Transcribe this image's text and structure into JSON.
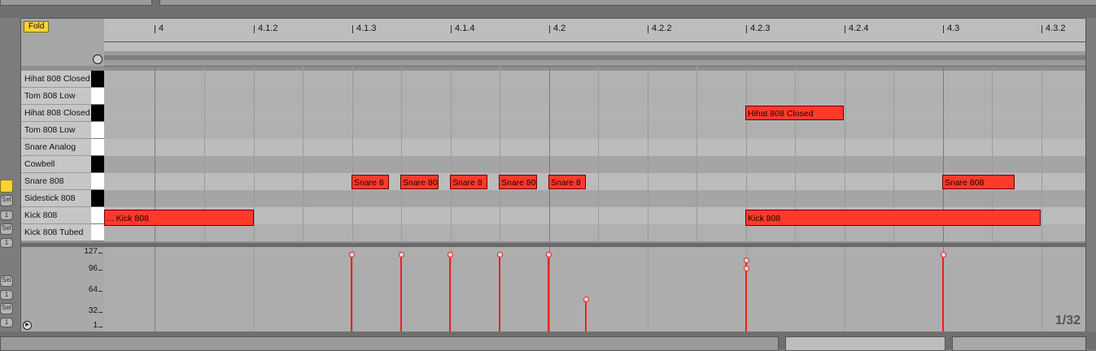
{
  "fold_label": "Fold",
  "ruler": {
    "labels": [
      "4",
      "4.1.2",
      "4.1.3",
      "4.1.4",
      "4.2",
      "4.2.2",
      "4.2.3",
      "4.2.4",
      "4.3",
      "4.3.2"
    ]
  },
  "keys": [
    {
      "name": "Hihat 808 Closed",
      "black": true
    },
    {
      "name": "Tom 808 Low",
      "black": false
    },
    {
      "name": "Hihat 808 Closed",
      "black": true
    },
    {
      "name": "Tom 808 Low",
      "black": false
    },
    {
      "name": "Snare Analog",
      "black": false
    },
    {
      "name": "Cowbell",
      "black": true
    },
    {
      "name": "Snare 808",
      "black": false
    },
    {
      "name": "Sidestick 808",
      "black": true
    },
    {
      "name": "Kick 808",
      "black": false
    },
    {
      "name": "Kick 808 Tubed",
      "black": false
    }
  ],
  "notes": {
    "hihat": "Hihat 808 Closed",
    "snare1": "Snare 8",
    "snare2": "Snare 80",
    "snare3": "Snare 8",
    "snare4": "Snare 80",
    "snare5": "Snare 8",
    "snare6": "Snare 808",
    "kick1": "... Kick 808",
    "kick2": "Kick 808"
  },
  "velocity_scale": [
    "127",
    "96",
    "64",
    "32",
    "1"
  ],
  "quantize": "1/32",
  "left_strip": [
    "Set",
    "1",
    "Set",
    "1",
    "Set",
    "1",
    "Set",
    "1"
  ],
  "colors": {
    "note": "#ff3a2a",
    "fold": "#f7d23b",
    "velocity": "#e8241a"
  }
}
